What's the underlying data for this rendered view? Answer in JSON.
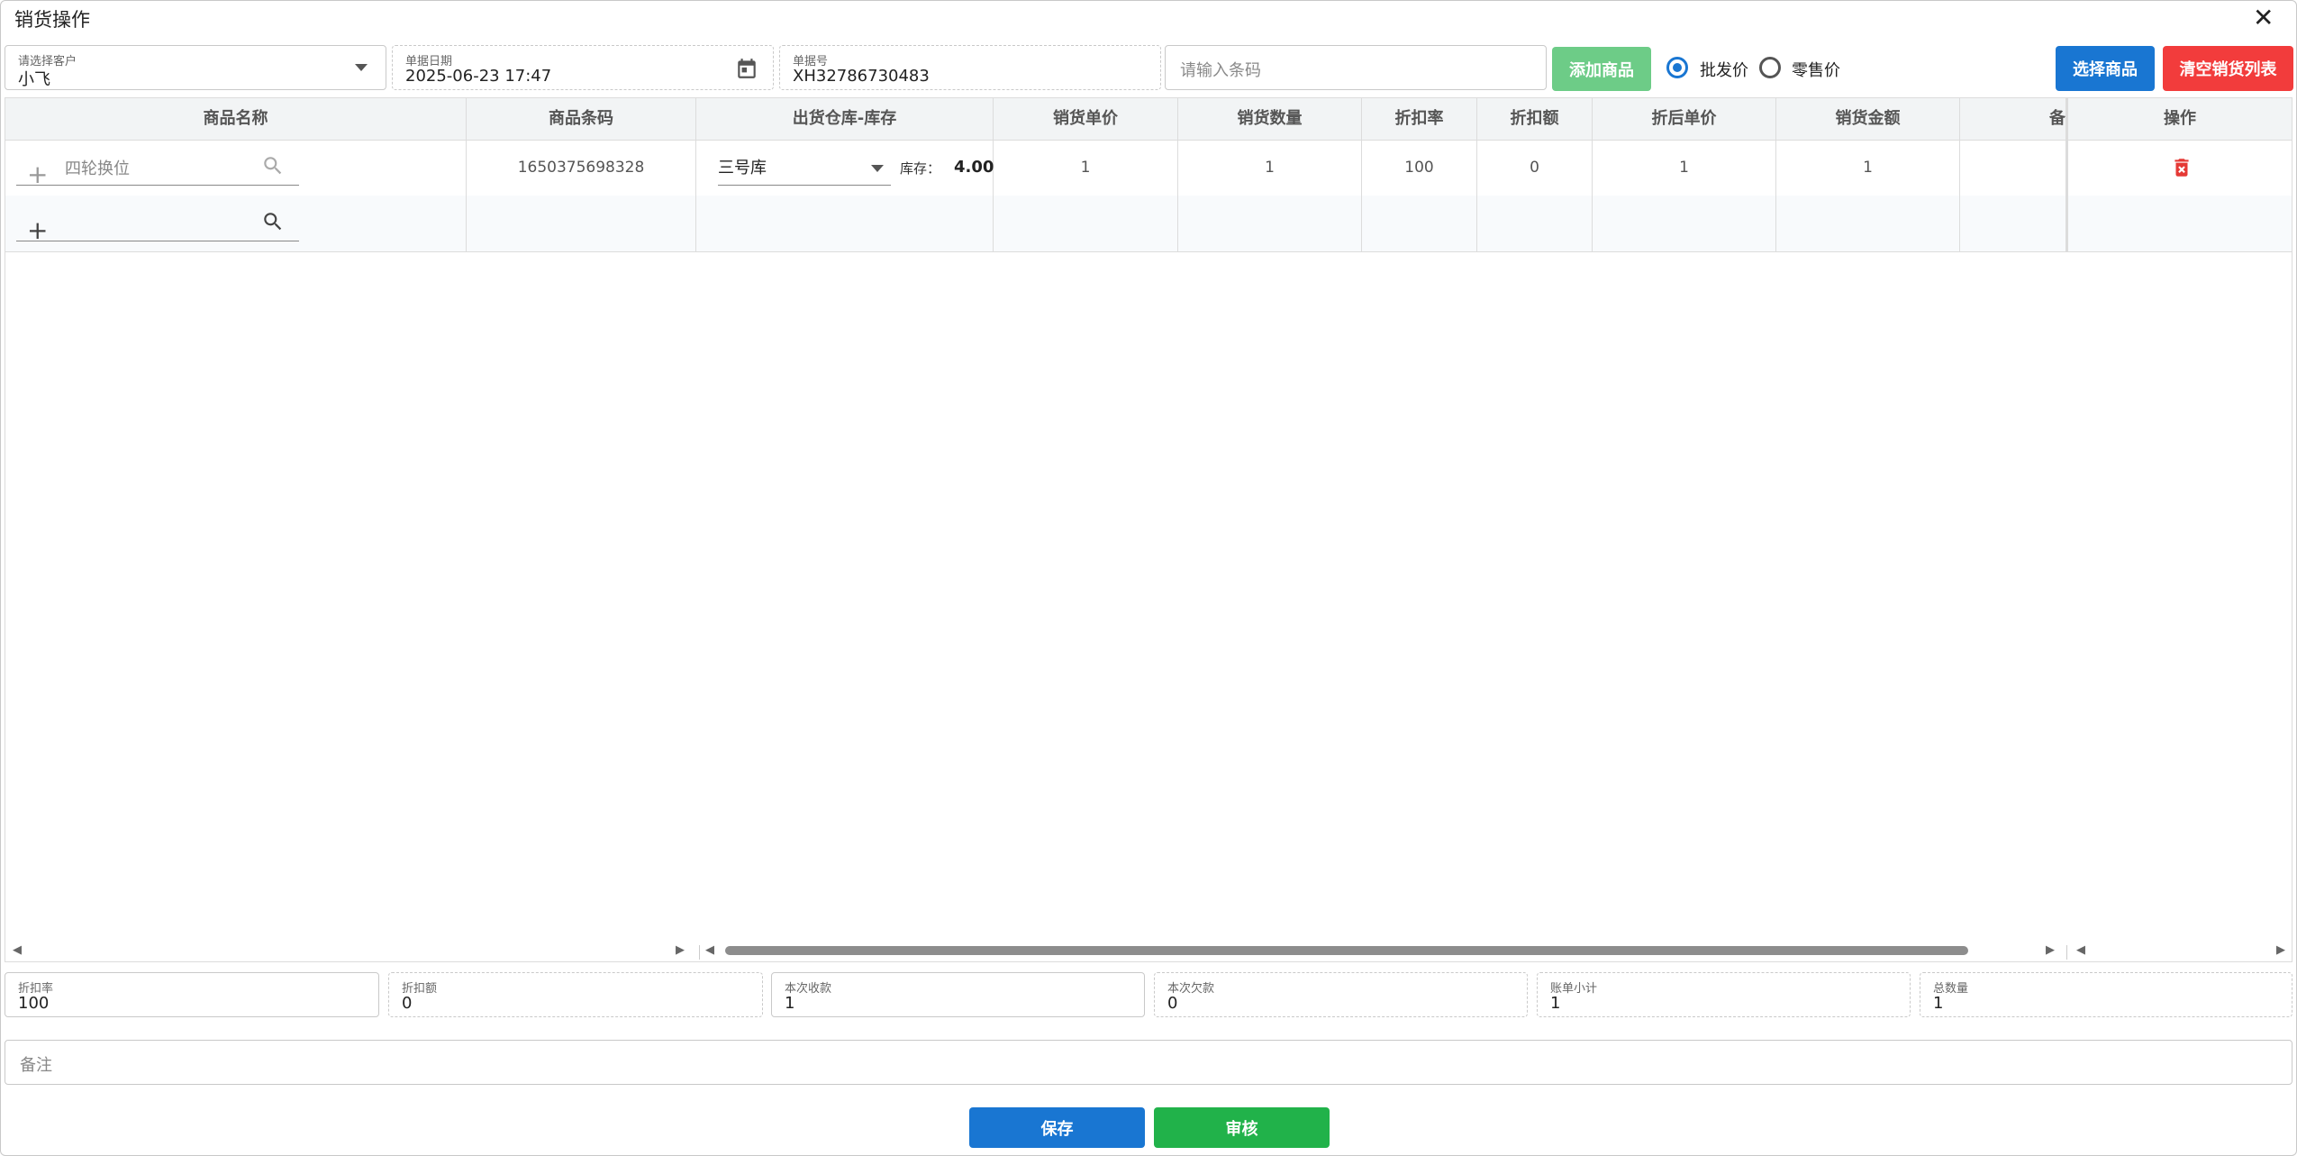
{
  "window": {
    "title": "销货操作"
  },
  "customer": {
    "label": "请选择客户",
    "value": "小飞"
  },
  "date": {
    "label": "单据日期",
    "value": "2025-06-23 17:47"
  },
  "order_no": {
    "label": "单据号",
    "value": "XH32786730483"
  },
  "barcode": {
    "placeholder": "请输入条码"
  },
  "buttons": {
    "add_product": "添加商品",
    "select_product": "选择商品",
    "clear_list": "清空销货列表",
    "save": "保存",
    "audit": "审核"
  },
  "price_type": {
    "wholesale": "批发价",
    "retail": "零售价",
    "selected": "wholesale"
  },
  "table": {
    "headers": [
      "商品名称",
      "商品条码",
      "出货仓库-库存",
      "销货单价",
      "销货数量",
      "折扣率",
      "折扣额",
      "折后单价",
      "销货金额",
      "备注",
      "操作"
    ],
    "rows": [
      {
        "name": "四轮换位",
        "barcode": "1650375698328",
        "warehouse": "三号库",
        "stock_label": "库存：",
        "stock": "4.00",
        "unit_price": "1",
        "quantity": "1",
        "discount_rate": "100",
        "discount_amount": "0",
        "discounted_price": "1",
        "amount": "1",
        "remark": ""
      }
    ]
  },
  "summary": {
    "discount_rate": {
      "label": "折扣率",
      "value": "100"
    },
    "discount_amount": {
      "label": "折扣额",
      "value": "0"
    },
    "received": {
      "label": "本次收款",
      "value": "1"
    },
    "owed": {
      "label": "本次欠款",
      "value": "0"
    },
    "subtotal": {
      "label": "账单小计",
      "value": "1"
    },
    "total_qty": {
      "label": "总数量",
      "value": "1"
    }
  },
  "remark": {
    "placeholder": "备注"
  },
  "colors": {
    "primary": "#1976d2",
    "success": "#21b24a",
    "danger": "#f23c3c",
    "add_button": "#6dcc87"
  },
  "icons": [
    "close-icon",
    "chevron-down-icon",
    "calendar-icon",
    "plus-icon",
    "search-icon",
    "delete-icon",
    "scroll-left-arrow-icon",
    "scroll-right-arrow-icon"
  ]
}
